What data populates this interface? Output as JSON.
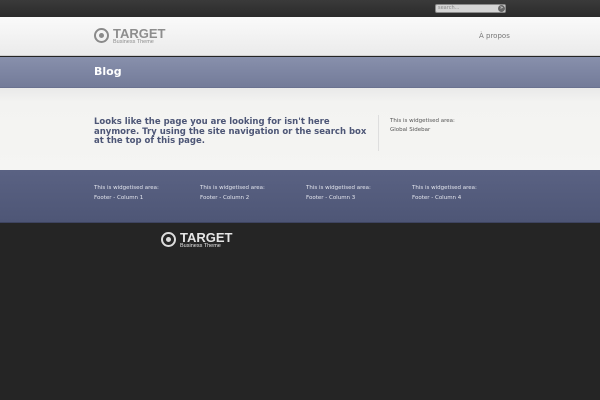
{
  "search": {
    "placeholder": "search...",
    "button_icon": "search-go-icon"
  },
  "header": {
    "logo_title": "TARGET",
    "logo_subtitle": "Business Theme",
    "nav": [
      {
        "label": "À propos"
      }
    ]
  },
  "page": {
    "title": "Blog",
    "message": "Looks like the page you are looking for isn't here anymore. Try using the site navigation or the search box at the top of this page."
  },
  "sidebar": {
    "line1": "This is widgetised area:",
    "line2": "Global Sidebar"
  },
  "footer_widgets": [
    {
      "line1": "This is widgetised area:",
      "line2": "Footer - Column 1"
    },
    {
      "line1": "This is widgetised area:",
      "line2": "Footer - Column 2"
    },
    {
      "line1": "This is widgetised area:",
      "line2": "Footer - Column 3"
    },
    {
      "line1": "This is widgetised area:",
      "line2": "Footer - Column 4"
    }
  ],
  "footer": {
    "logo_title": "TARGET",
    "logo_subtitle": "Business Theme"
  },
  "colors": {
    "title_band": "#7d85a2",
    "message_text": "#4d5676",
    "footer_widgets_bg": "#545c7c",
    "footer_bg": "#252525"
  }
}
